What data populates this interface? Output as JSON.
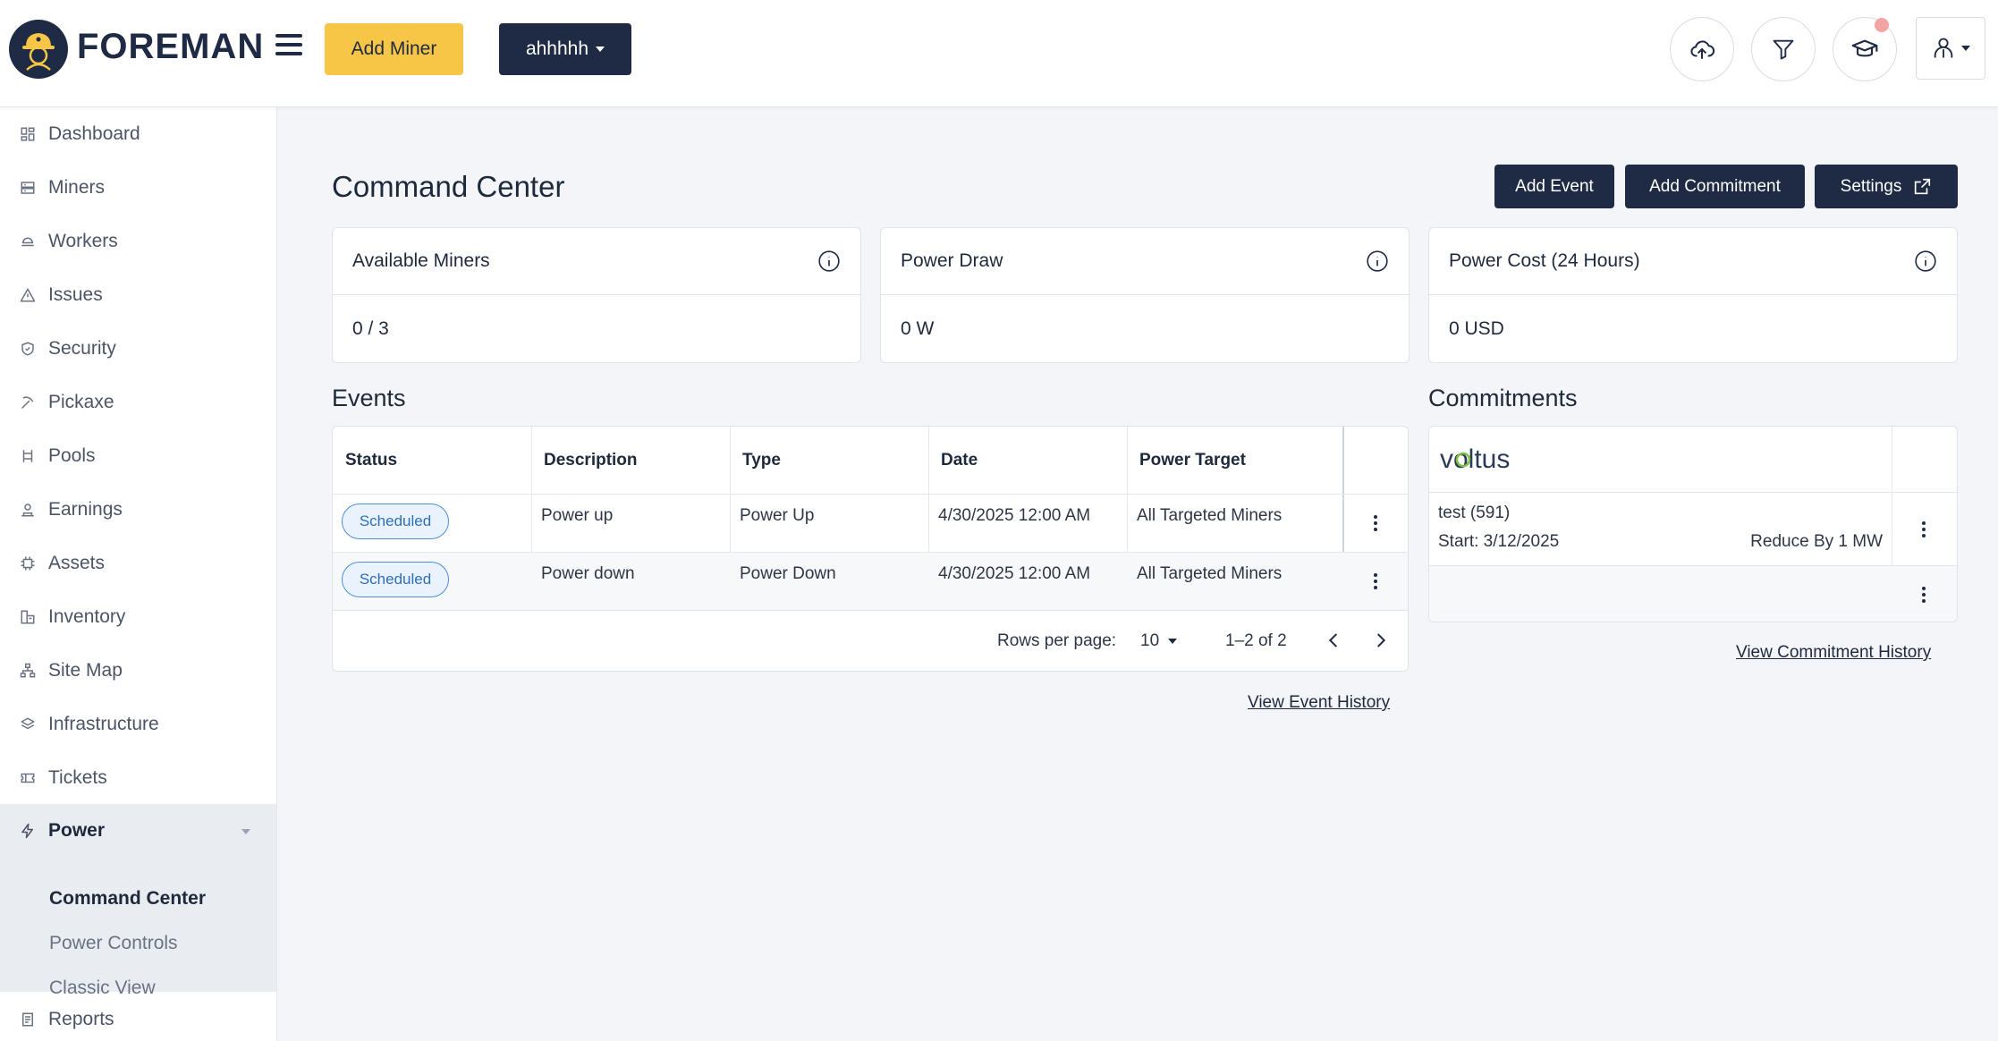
{
  "header": {
    "brand": "FOREMAN",
    "add_miner_label": "Add Miner",
    "site_selector_label": "ahhhhh",
    "icons": [
      "cloud-upload-icon",
      "filter-icon",
      "graduation-cap-icon",
      "user-icon"
    ]
  },
  "sidebar": {
    "items": [
      {
        "label": "Dashboard",
        "icon": "dashboard-icon"
      },
      {
        "label": "Miners",
        "icon": "server-icon"
      },
      {
        "label": "Workers",
        "icon": "workers-icon"
      },
      {
        "label": "Issues",
        "icon": "warning-icon"
      },
      {
        "label": "Security",
        "icon": "shield-icon"
      },
      {
        "label": "Pickaxe",
        "icon": "pickaxe-icon"
      },
      {
        "label": "Pools",
        "icon": "pools-icon"
      },
      {
        "label": "Earnings",
        "icon": "earnings-icon"
      },
      {
        "label": "Assets",
        "icon": "chip-icon"
      },
      {
        "label": "Inventory",
        "icon": "inventory-icon"
      },
      {
        "label": "Site Map",
        "icon": "sitemap-icon"
      },
      {
        "label": "Infrastructure",
        "icon": "layers-icon"
      },
      {
        "label": "Tickets",
        "icon": "ticket-icon"
      },
      {
        "label": "Power",
        "icon": "lightning-icon"
      },
      {
        "label": "Reports",
        "icon": "report-icon"
      }
    ],
    "power_sub": [
      {
        "label": "Command Center",
        "active": true
      },
      {
        "label": "Power Controls",
        "active": false
      },
      {
        "label": "Classic View",
        "active": false
      }
    ]
  },
  "main": {
    "title": "Command Center",
    "actions": {
      "add_event": "Add Event",
      "add_commitment": "Add Commitment",
      "settings": "Settings"
    },
    "cards": [
      {
        "title": "Available Miners",
        "value": "0 / 3"
      },
      {
        "title": "Power Draw",
        "value": "0 W"
      },
      {
        "title": "Power Cost (24 Hours)",
        "value": "0 USD"
      }
    ],
    "events": {
      "title": "Events",
      "columns": [
        "Status",
        "Description",
        "Type",
        "Date",
        "Power Target"
      ],
      "rows": [
        {
          "status": "Scheduled",
          "description": "Power up",
          "type": "Power Up",
          "date": "4/30/2025 12:00 AM",
          "target": "All Targeted Miners"
        },
        {
          "status": "Scheduled",
          "description": "Power down",
          "type": "Power Down",
          "date": "4/30/2025 12:00 AM",
          "target": "All Targeted Miners"
        }
      ],
      "rows_per_page_label": "Rows per page:",
      "rows_per_page": "10",
      "range": "1–2 of 2",
      "history_link": "View Event History"
    },
    "commitments": {
      "title": "Commitments",
      "provider_logo": "voltus",
      "items": [
        {
          "name": "test (591)",
          "start": "Start: 3/12/2025",
          "reduction": "Reduce By 1 MW"
        }
      ],
      "history_link": "View Commitment History"
    }
  }
}
